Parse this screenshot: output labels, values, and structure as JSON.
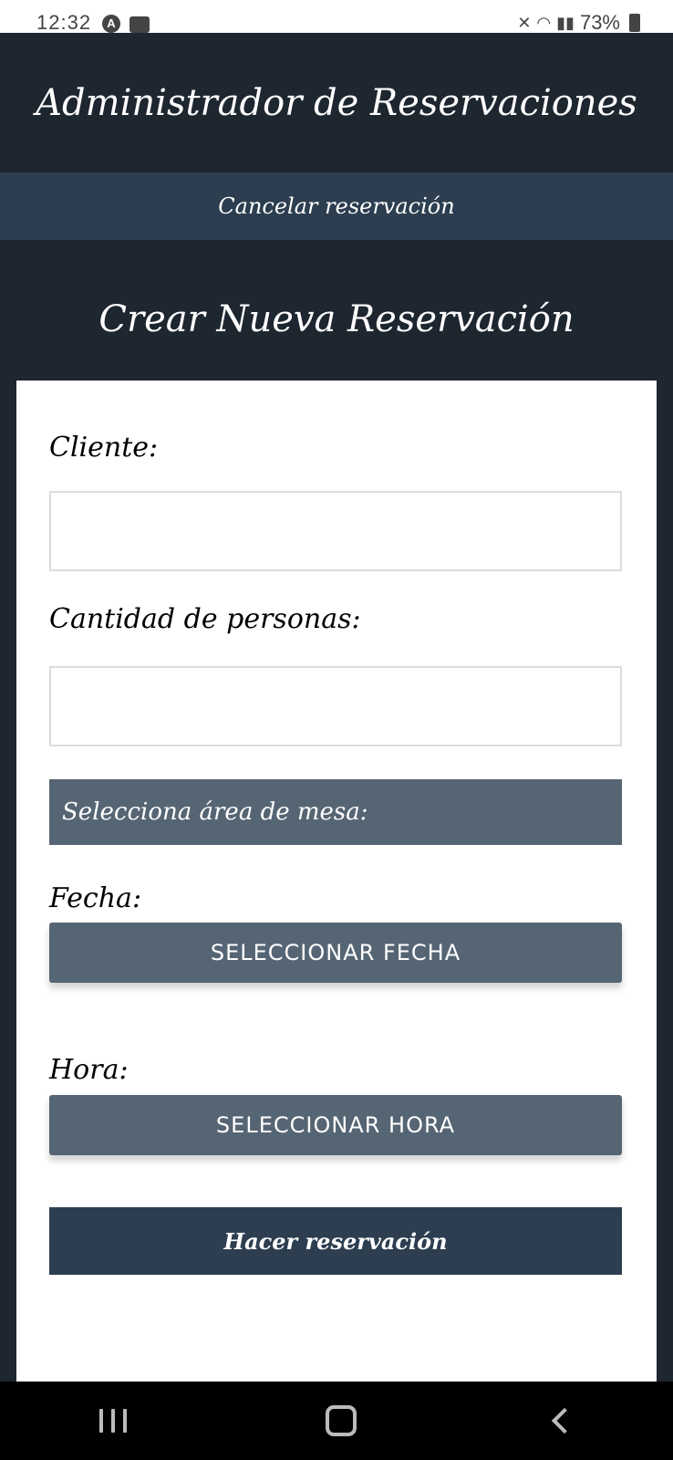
{
  "status_bar": {
    "time": "12:32",
    "battery": "73%"
  },
  "header": {
    "title": "Administrador de Reservaciones"
  },
  "nav": {
    "cancel_label": "Cancelar reservación"
  },
  "form": {
    "title": "Crear Nueva Reservación",
    "client_label": "Cliente:",
    "client_value": "",
    "people_label": "Cantidad de personas:",
    "people_value": "",
    "area_select_label": "Selecciona área de mesa:",
    "date_label": "Fecha:",
    "date_button": "SELECCIONAR FECHA",
    "time_label": "Hora:",
    "time_button": "SELECCIONAR HORA",
    "submit_label": "Hacer reservación"
  },
  "colors": {
    "background": "#1e2630",
    "nav_bar": "#2c3e50",
    "button_gray": "#566574",
    "submit": "#2c3e50"
  },
  "system_nav": {
    "icons": [
      "recent-apps-icon",
      "home-icon",
      "back-icon"
    ]
  }
}
